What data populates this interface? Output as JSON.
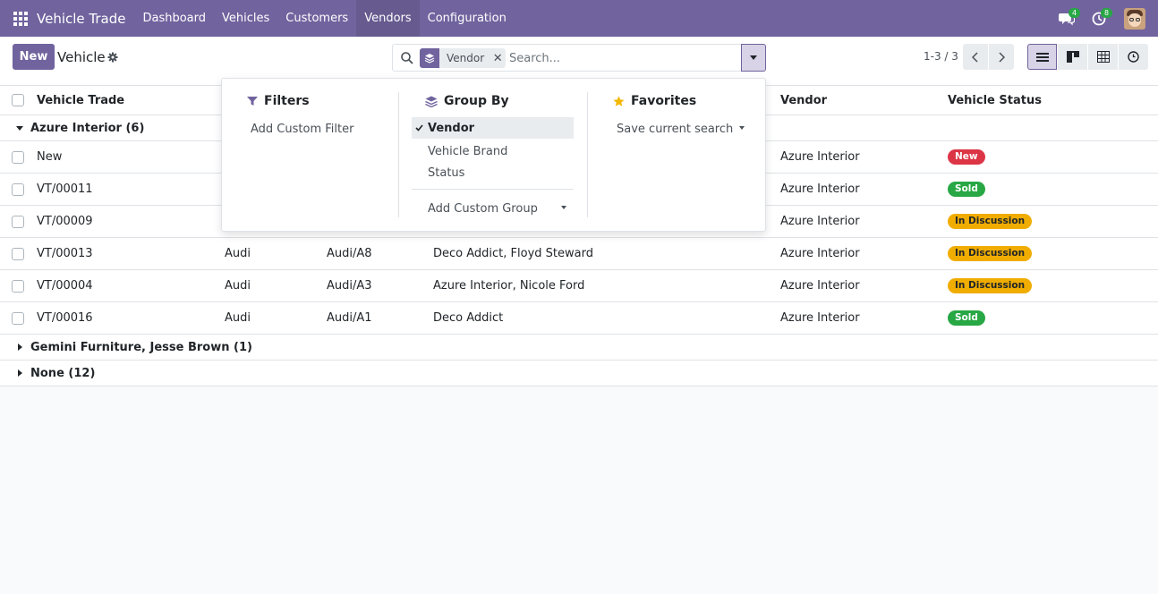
{
  "navbar": {
    "app_title": "Vehicle Trade",
    "menu": [
      "Dashboard",
      "Vehicles",
      "Customers",
      "Vendors",
      "Configuration"
    ],
    "active_menu": "Vendors",
    "messages_count": "4",
    "activities_count": "8"
  },
  "control_panel": {
    "new_label": "New",
    "breadcrumb": "Vehicle",
    "search_placeholder": "Search...",
    "facet_label": "Vendor",
    "pager": "1-3 / 3"
  },
  "table": {
    "headers": {
      "name": "Vehicle Trade",
      "vendor": "Vendor",
      "status": "Vehicle Status"
    },
    "groups": [
      {
        "label": "Azure Interior (6)",
        "expanded": true
      },
      {
        "label": "Gemini Furniture, Jesse Brown (1)",
        "expanded": false
      },
      {
        "label": "None (12)",
        "expanded": false
      }
    ],
    "rows": [
      {
        "name": "New",
        "brand": "",
        "model": "",
        "customer": "",
        "vendor": "Azure Interior",
        "status": "New"
      },
      {
        "name": "VT/00011",
        "brand": "",
        "model": "",
        "customer": "",
        "vendor": "Azure Interior",
        "status": "Sold"
      },
      {
        "name": "VT/00009",
        "brand": "",
        "model": "",
        "customer": "",
        "vendor": "Azure Interior",
        "status": "In Discussion"
      },
      {
        "name": "VT/00013",
        "brand": "Audi",
        "model": "Audi/A8",
        "customer": "Deco Addict, Floyd Steward",
        "vendor": "Azure Interior",
        "status": "In Discussion"
      },
      {
        "name": "VT/00004",
        "brand": "Audi",
        "model": "Audi/A3",
        "customer": "Azure Interior, Nicole Ford",
        "vendor": "Azure Interior",
        "status": "In Discussion"
      },
      {
        "name": "VT/00016",
        "brand": "Audi",
        "model": "Audi/A1",
        "customer": "Deco Addict",
        "vendor": "Azure Interior",
        "status": "Sold"
      }
    ]
  },
  "dropdown": {
    "filters_title": "Filters",
    "add_custom_filter": "Add Custom Filter",
    "groupby_title": "Group By",
    "groupby_options": [
      "Vendor",
      "Vehicle Brand",
      "Status"
    ],
    "add_custom_group": "Add Custom Group",
    "favorites_title": "Favorites",
    "save_current_search": "Save current search"
  },
  "colors": {
    "primary": "#71639e",
    "status_new": "#dc3545",
    "status_sold": "#28a745",
    "status_in_discussion": "#f0ad00"
  }
}
